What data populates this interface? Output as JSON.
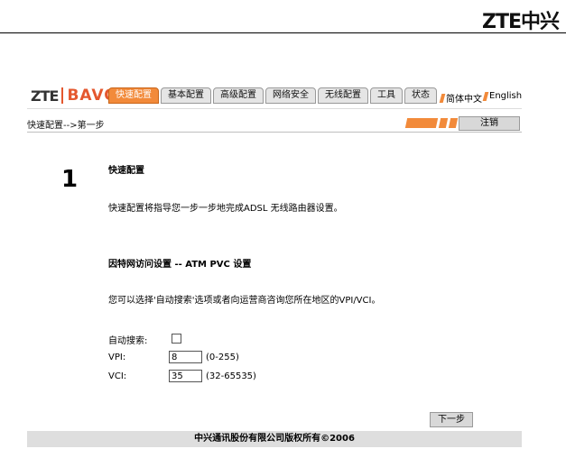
{
  "doc_logo": "ZTE中兴",
  "brand": {
    "zte": "ZTE",
    "bavo": "BAVO"
  },
  "tabs": [
    {
      "label": "快速配置",
      "active": true
    },
    {
      "label": "基本配置",
      "active": false
    },
    {
      "label": "高级配置",
      "active": false
    },
    {
      "label": "网络安全",
      "active": false
    },
    {
      "label": "无线配置",
      "active": false
    },
    {
      "label": "工具",
      "active": false
    },
    {
      "label": "状态",
      "active": false
    }
  ],
  "lang": {
    "zh": "简体中文",
    "en": "English"
  },
  "breadcrumb": "快速配置-->第一步",
  "logout_label": "注销",
  "step": {
    "number": "1",
    "title": "快速配置",
    "description": "快速配置将指导您一步一步地完成ADSL 无线路由器设置。"
  },
  "section": {
    "title": "因特网访问设置 -- ATM PVC 设置",
    "hint": "您可以选择'自动搜索'选项或者向运营商咨询您所在地区的VPI/VCI。"
  },
  "form": {
    "auto_search_label": "自动搜索:",
    "vpi_label": "VPI:",
    "vpi_value": "8",
    "vpi_range": "(0-255)",
    "vci_label": "VCI:",
    "vci_value": "35",
    "vci_range": "(32-65535)"
  },
  "next_label": "下一步",
  "footer": "中兴通讯股份有限公司版权所有©2006",
  "colors": {
    "accent": "#f28a3a",
    "brand_red": "#e4572e"
  }
}
